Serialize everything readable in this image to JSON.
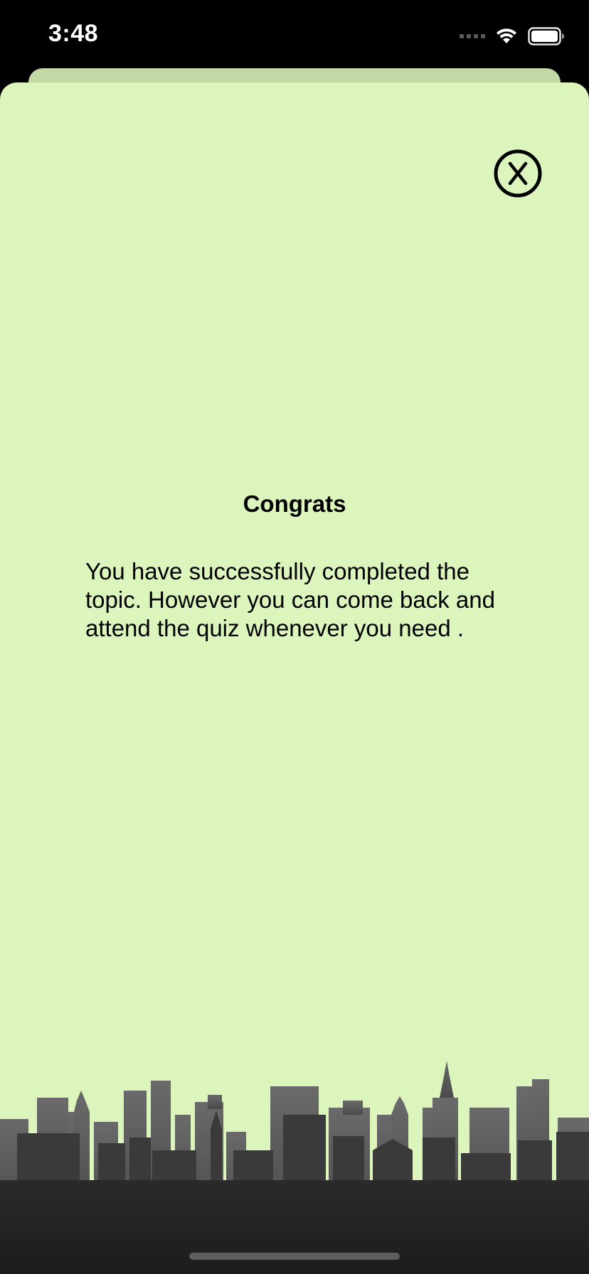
{
  "status_bar": {
    "time": "3:48"
  },
  "modal": {
    "title": "Congrats",
    "message": "You have successfully completed the topic. However you can come back and attend the quiz whenever you need .",
    "close_icon": "close-circle-x-icon"
  },
  "colors": {
    "sheet_background": "#dcf5bd",
    "back_card": "#c3d9a5",
    "skyline_front": "#3a3a3a",
    "skyline_back": "#666666"
  }
}
